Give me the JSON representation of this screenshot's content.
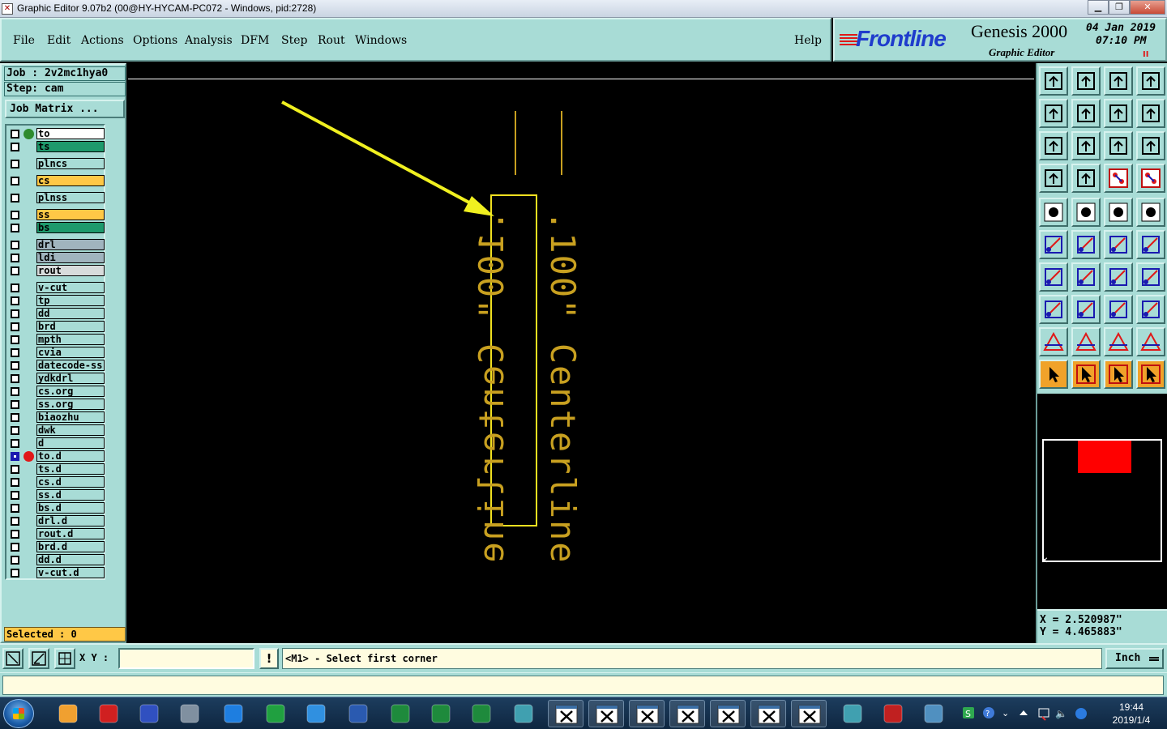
{
  "window": {
    "title": "Graphic Editor 9.07b2 (00@HY-HYCAM-PC072 - Windows, pid:2728)",
    "minimize_glyph": "▁",
    "restore_glyph": "❐",
    "close_glyph": "✕"
  },
  "menu": {
    "items": [
      "File",
      "Edit",
      "Actions",
      "Options",
      "Analysis",
      "DFM",
      "Step",
      "Rout",
      "Windows"
    ],
    "help": "Help"
  },
  "brand": {
    "logo": "Frontline",
    "product": "Genesis 2000",
    "subtitle": "Graphic Editor",
    "date": "04 Jan 2019",
    "time": "07:10 PM",
    "status_glyph": "II"
  },
  "left": {
    "job": "Job : 2v2mc1hya0",
    "step": "Step: cam",
    "job_matrix": "Job Matrix ...",
    "selected": "Selected : 0",
    "layers": [
      {
        "name": "to",
        "color": "#ffffff",
        "dot": "#2e8b2e"
      },
      {
        "name": "ts",
        "color": "#1e9a6c",
        "dot": ""
      },
      {
        "name": "plncs",
        "color": "#a8dcd6",
        "dot": ""
      },
      {
        "name": "cs",
        "color": "#ffc846",
        "dot": ""
      },
      {
        "name": "plnss",
        "color": "#a8dcd6",
        "dot": ""
      },
      {
        "name": "ss",
        "color": "#ffc846",
        "dot": ""
      },
      {
        "name": "bs",
        "color": "#1e9a6c",
        "dot": ""
      },
      {
        "name": "drl",
        "color": "#a0b4be",
        "dot": ""
      },
      {
        "name": "ldi",
        "color": "#a0b4be",
        "dot": ""
      },
      {
        "name": "rout",
        "color": "#d8dcdc",
        "dot": ""
      },
      {
        "name": "v-cut",
        "color": "#a8dcd6",
        "dot": ""
      },
      {
        "name": "tp",
        "color": "#a8dcd6",
        "dot": ""
      },
      {
        "name": "dd",
        "color": "#a8dcd6",
        "dot": ""
      },
      {
        "name": "brd",
        "color": "#a8dcd6",
        "dot": ""
      },
      {
        "name": "mpth",
        "color": "#a8dcd6",
        "dot": ""
      },
      {
        "name": "cvia",
        "color": "#a8dcd6",
        "dot": ""
      },
      {
        "name": "datecode-ss",
        "color": "#a8dcd6",
        "dot": ""
      },
      {
        "name": "ydkdrl",
        "color": "#a8dcd6",
        "dot": ""
      },
      {
        "name": "cs.org",
        "color": "#a8dcd6",
        "dot": ""
      },
      {
        "name": "ss.org",
        "color": "#a8dcd6",
        "dot": ""
      },
      {
        "name": "biaozhu",
        "color": "#a8dcd6",
        "dot": ""
      },
      {
        "name": "dwk",
        "color": "#a8dcd6",
        "dot": ""
      },
      {
        "name": "d",
        "color": "#a8dcd6",
        "dot": ""
      },
      {
        "name": "to.d",
        "color": "#a8dcd6",
        "dot": "#e01818",
        "active": true
      },
      {
        "name": "ts.d",
        "color": "#a8dcd6",
        "dot": ""
      },
      {
        "name": "cs.d",
        "color": "#a8dcd6",
        "dot": ""
      },
      {
        "name": "ss.d",
        "color": "#a8dcd6",
        "dot": ""
      },
      {
        "name": "bs.d",
        "color": "#a8dcd6",
        "dot": ""
      },
      {
        "name": "drl.d",
        "color": "#a8dcd6",
        "dot": ""
      },
      {
        "name": "rout.d",
        "color": "#a8dcd6",
        "dot": ""
      },
      {
        "name": "brd.d",
        "color": "#a8dcd6",
        "dot": ""
      },
      {
        "name": "dd.d",
        "color": "#a8dcd6",
        "dot": ""
      },
      {
        "name": "v-cut.d",
        "color": "#a8dcd6",
        "dot": ""
      }
    ]
  },
  "canvas": {
    "text_left": ".100\" Centerline",
    "text_right": ".100\" Centerline",
    "feature_color": "#c8a020",
    "select_color": "#f0e020",
    "arrow_color": "#f0f020"
  },
  "coords": {
    "x": "X = 2.520987\"",
    "y": "Y = 4.465883\""
  },
  "command": {
    "xy_label": "X Y :",
    "xy_value": "",
    "excl": "!",
    "prompt": "<M1> - Select first corner",
    "units": "Inch"
  },
  "taskbar": {
    "clock_time": "19:44",
    "clock_date": "2019/1/4"
  }
}
